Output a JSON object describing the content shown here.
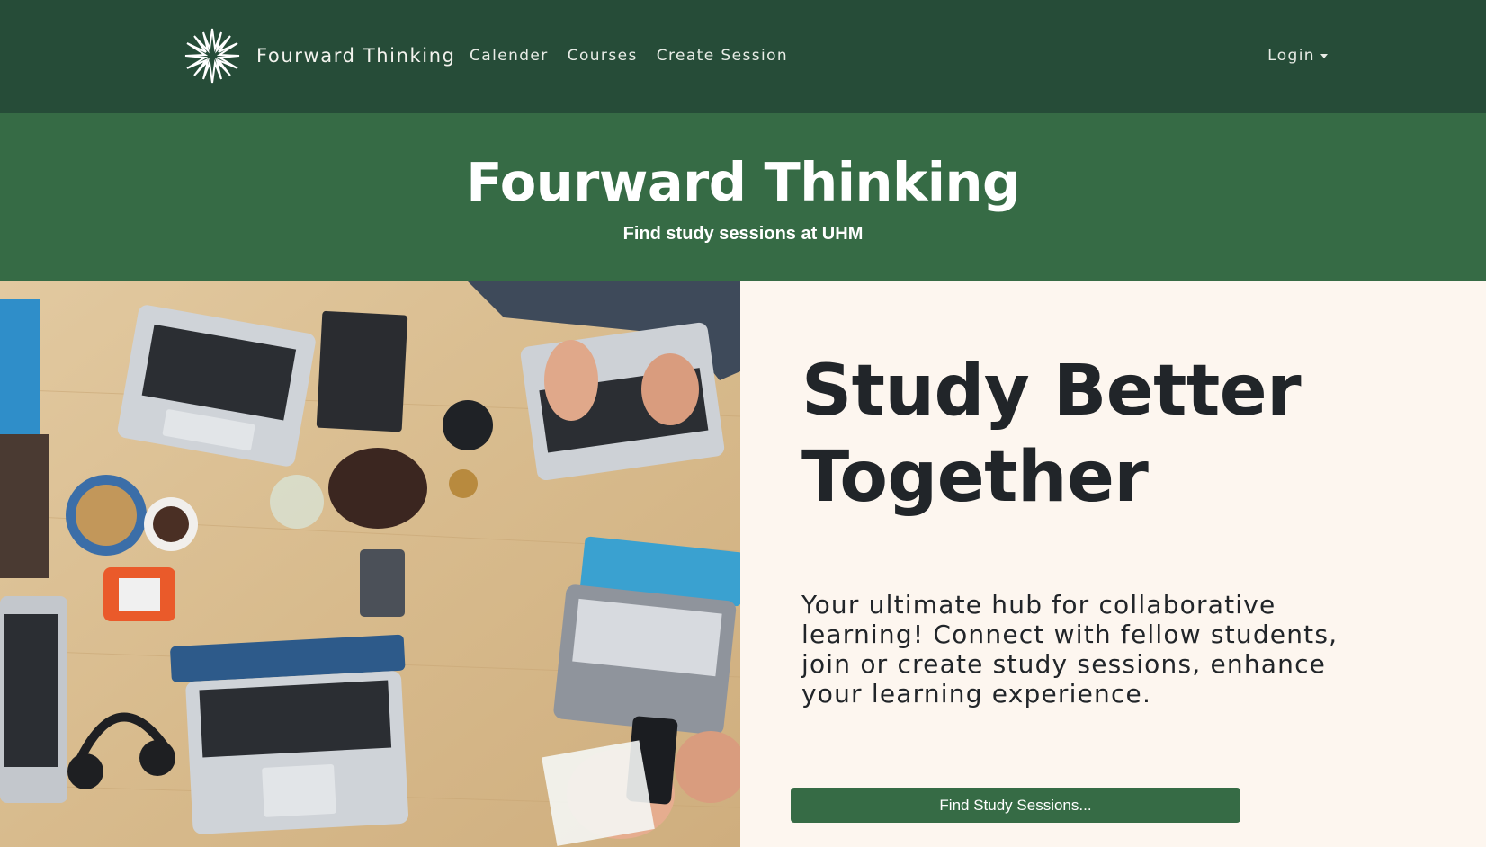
{
  "navbar": {
    "brand_name": "Fourward Thinking",
    "logo_icon": "starburst-logo-icon",
    "links": [
      "Calender",
      "Courses",
      "Create Session"
    ],
    "login_label": "Login",
    "background": "#264c38"
  },
  "hero": {
    "title": "Fourward Thinking",
    "subtitle": "Find study sessions at UHM",
    "background": "#366b45"
  },
  "main": {
    "image": "study-group-desk-photo",
    "headline": "Study Better Together",
    "description": "Your ultimate hub for collaborative learning! Connect with fellow students, join or create study sessions, enhance your learning experience.",
    "cta_label": "Find Study Sessions...",
    "background": "#fdf6ef"
  }
}
